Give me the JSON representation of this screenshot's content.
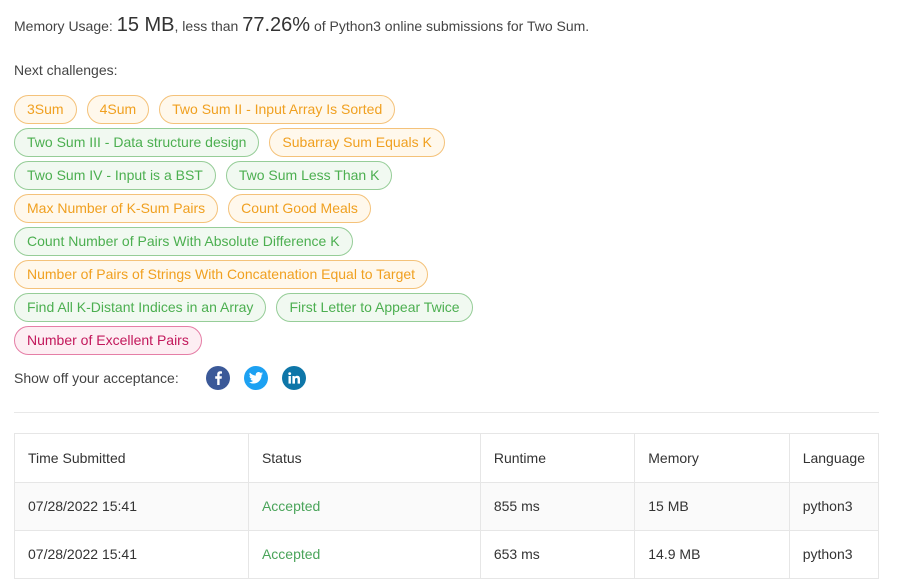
{
  "memory": {
    "prefix": "Memory Usage:",
    "value": "15 MB",
    "middle": ", less than",
    "percent": "77.26%",
    "suffix": "of Python3 online submissions for Two Sum."
  },
  "next_challenges": {
    "label": "Next challenges:",
    "rows": [
      [
        {
          "label": "3Sum",
          "difficulty": "medium"
        },
        {
          "label": "4Sum",
          "difficulty": "medium"
        },
        {
          "label": "Two Sum II - Input Array Is Sorted",
          "difficulty": "medium"
        }
      ],
      [
        {
          "label": "Two Sum III - Data structure design",
          "difficulty": "easy"
        },
        {
          "label": "Subarray Sum Equals K",
          "difficulty": "medium"
        }
      ],
      [
        {
          "label": "Two Sum IV - Input is a BST",
          "difficulty": "easy"
        },
        {
          "label": "Two Sum Less Than K",
          "difficulty": "easy"
        }
      ],
      [
        {
          "label": "Max Number of K-Sum Pairs",
          "difficulty": "medium"
        },
        {
          "label": "Count Good Meals",
          "difficulty": "medium"
        }
      ],
      [
        {
          "label": "Count Number of Pairs With Absolute Difference K",
          "difficulty": "easy"
        }
      ],
      [
        {
          "label": "Number of Pairs of Strings With Concatenation Equal to Target",
          "difficulty": "medium"
        }
      ],
      [
        {
          "label": "Find All K-Distant Indices in an Array",
          "difficulty": "easy"
        },
        {
          "label": "First Letter to Appear Twice",
          "difficulty": "easy"
        }
      ],
      [
        {
          "label": "Number of Excellent Pairs",
          "difficulty": "hard"
        }
      ]
    ]
  },
  "share": {
    "label": "Show off your acceptance:",
    "icons": [
      "facebook-icon",
      "twitter-icon",
      "linkedin-icon"
    ]
  },
  "submissions": {
    "columns": [
      "Time Submitted",
      "Status",
      "Runtime",
      "Memory",
      "Language"
    ],
    "rows": [
      [
        "07/28/2022 15:41",
        "Accepted",
        "855 ms",
        "15 MB",
        "python3"
      ],
      [
        "07/28/2022 15:41",
        "Accepted",
        "653 ms",
        "14.9 MB",
        "python3"
      ]
    ]
  },
  "colors": {
    "medium": "#f0a020",
    "easy": "#4caf50",
    "hard": "#c2185b",
    "accepted": "#4aa45a"
  }
}
